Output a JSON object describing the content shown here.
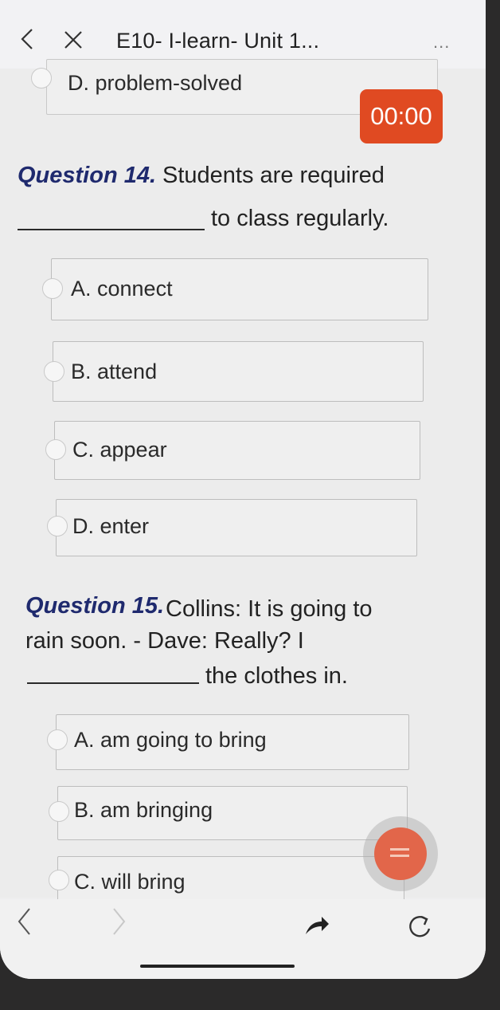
{
  "header": {
    "title": "E10- I-learn- Unit 1...",
    "more": "..."
  },
  "timer": "00:00",
  "prev_option": "D. problem-solved",
  "questions": [
    {
      "label": "Question 14.",
      "line1": "Students are required",
      "line2": "to class regularly.",
      "options": [
        "A. connect",
        "B. attend",
        "C. appear",
        "D. enter"
      ]
    },
    {
      "label": "Question 15.",
      "line1": "Collins: It is going to",
      "line2": "rain soon. - Dave: Really? I",
      "line3": "the clothes in.",
      "options": [
        "A. am going to bring",
        "B. am bringing",
        "C. will bring"
      ]
    }
  ],
  "icons": {
    "back": "chevron-left-icon",
    "close": "close-icon",
    "more": "more-icon",
    "share": "share-arrow-icon",
    "reload": "reload-icon",
    "fab": "list-icon"
  },
  "colors": {
    "accent": "#e04a22",
    "question_label": "#1f2a6e"
  }
}
